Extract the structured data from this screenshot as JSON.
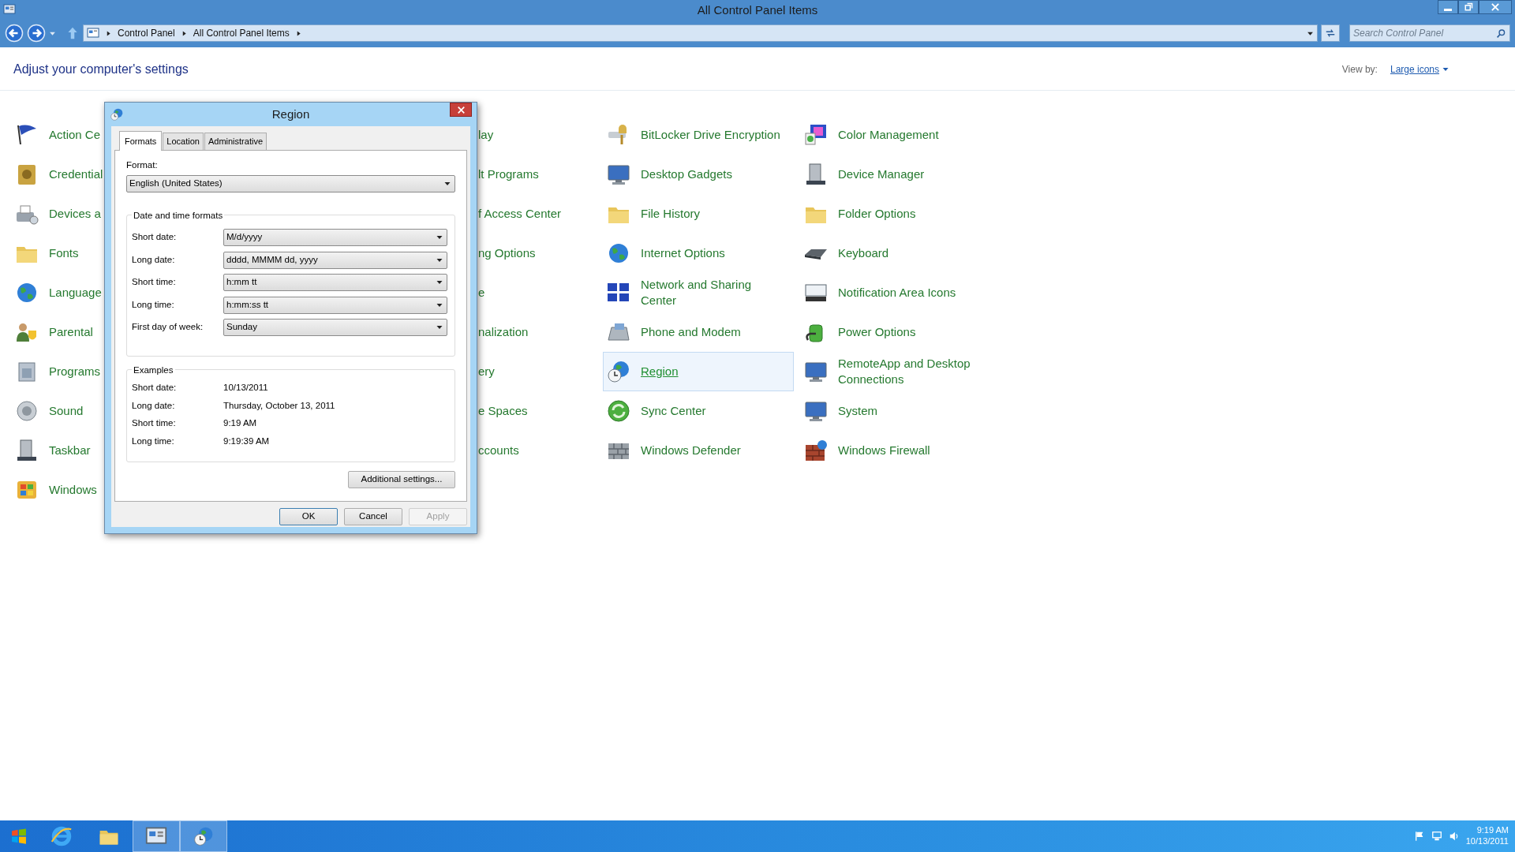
{
  "window": {
    "title": "All Control Panel Items"
  },
  "address_bar": {
    "path": [
      "Control Panel",
      "All Control Panel Items"
    ]
  },
  "search": {
    "placeholder": "Search Control Panel"
  },
  "heading": "Adjust your computer's settings",
  "view_by": {
    "label": "View by:",
    "value": "Large icons"
  },
  "columns": [
    {
      "kind": "icons",
      "items": [
        {
          "label": "Action Ce",
          "selected": false
        },
        {
          "label": "Credential",
          "selected": false
        },
        {
          "label": "Devices a",
          "selected": false
        },
        {
          "label": "Fonts",
          "selected": false
        },
        {
          "label": "Language",
          "selected": false
        },
        {
          "label": "Parental",
          "selected": false
        },
        {
          "label": "Programs",
          "selected": false
        },
        {
          "label": "Sound",
          "selected": false
        },
        {
          "label": "Taskbar",
          "selected": false
        },
        {
          "label": "Windows",
          "selected": false
        }
      ]
    },
    {
      "kind": "text",
      "items": [
        {
          "label": "lay",
          "selected": false
        },
        {
          "label": "lt Programs",
          "selected": false
        },
        {
          "label": "f Access Center",
          "selected": false
        },
        {
          "label": "ng Options",
          "selected": false
        },
        {
          "label": "e",
          "selected": false
        },
        {
          "label": "nalization",
          "selected": false
        },
        {
          "label": "ery",
          "selected": false
        },
        {
          "label": "e Spaces",
          "selected": false
        },
        {
          "label": "ccounts",
          "selected": false
        }
      ]
    },
    {
      "kind": "icons",
      "items": [
        {
          "label": "BitLocker Drive Encryption",
          "selected": false
        },
        {
          "label": "Desktop Gadgets",
          "selected": false
        },
        {
          "label": "File History",
          "selected": false
        },
        {
          "label": "Internet Options",
          "selected": false
        },
        {
          "label": "Network and Sharing Center",
          "selected": false
        },
        {
          "label": "Phone and Modem",
          "selected": false
        },
        {
          "label": "Region",
          "selected": true
        },
        {
          "label": "Sync Center",
          "selected": false
        },
        {
          "label": "Windows Defender",
          "selected": false
        }
      ]
    },
    {
      "kind": "icons",
      "items": [
        {
          "label": "Color Management",
          "selected": false
        },
        {
          "label": "Device Manager",
          "selected": false
        },
        {
          "label": "Folder Options",
          "selected": false
        },
        {
          "label": "Keyboard",
          "selected": false
        },
        {
          "label": "Notification Area Icons",
          "selected": false
        },
        {
          "label": "Power Options",
          "selected": false
        },
        {
          "label": "RemoteApp and Desktop Connections",
          "selected": false
        },
        {
          "label": "System",
          "selected": false
        },
        {
          "label": "Windows Firewall",
          "selected": false
        }
      ]
    }
  ],
  "dialog": {
    "title": "Region",
    "tabs": [
      {
        "label": "Formats",
        "selected": true
      },
      {
        "label": "Location",
        "selected": false
      },
      {
        "label": "Administrative",
        "selected": false
      }
    ],
    "format_label": "Format:",
    "format_value": "English (United States)",
    "formats_group": {
      "title": "Date and time formats",
      "rows": [
        {
          "label": "Short date:",
          "value": "M/d/yyyy"
        },
        {
          "label": "Long date:",
          "value": "dddd, MMMM dd, yyyy"
        },
        {
          "label": "Short time:",
          "value": "h:mm tt"
        },
        {
          "label": "Long time:",
          "value": "h:mm:ss tt"
        },
        {
          "label": "First day of week:",
          "value": "Sunday"
        }
      ]
    },
    "examples_group": {
      "title": "Examples",
      "rows": [
        {
          "label": "Short date:",
          "value": "10/13/2011"
        },
        {
          "label": "Long date:",
          "value": "Thursday, October 13, 2011"
        },
        {
          "label": "Short time:",
          "value": "9:19 AM"
        },
        {
          "label": "Long time:",
          "value": "9:19:39 AM"
        }
      ]
    },
    "additional_button": "Additional settings...",
    "buttons": [
      {
        "label": "OK",
        "disabled": false
      },
      {
        "label": "Cancel",
        "disabled": false
      },
      {
        "label": "Apply",
        "disabled": true
      }
    ]
  },
  "taskbar": {
    "apps": [
      {
        "active": false
      },
      {
        "active": false
      },
      {
        "active": true
      },
      {
        "active": true
      }
    ],
    "clock": {
      "time": "9:19 AM",
      "date": "10/13/2011"
    }
  }
}
